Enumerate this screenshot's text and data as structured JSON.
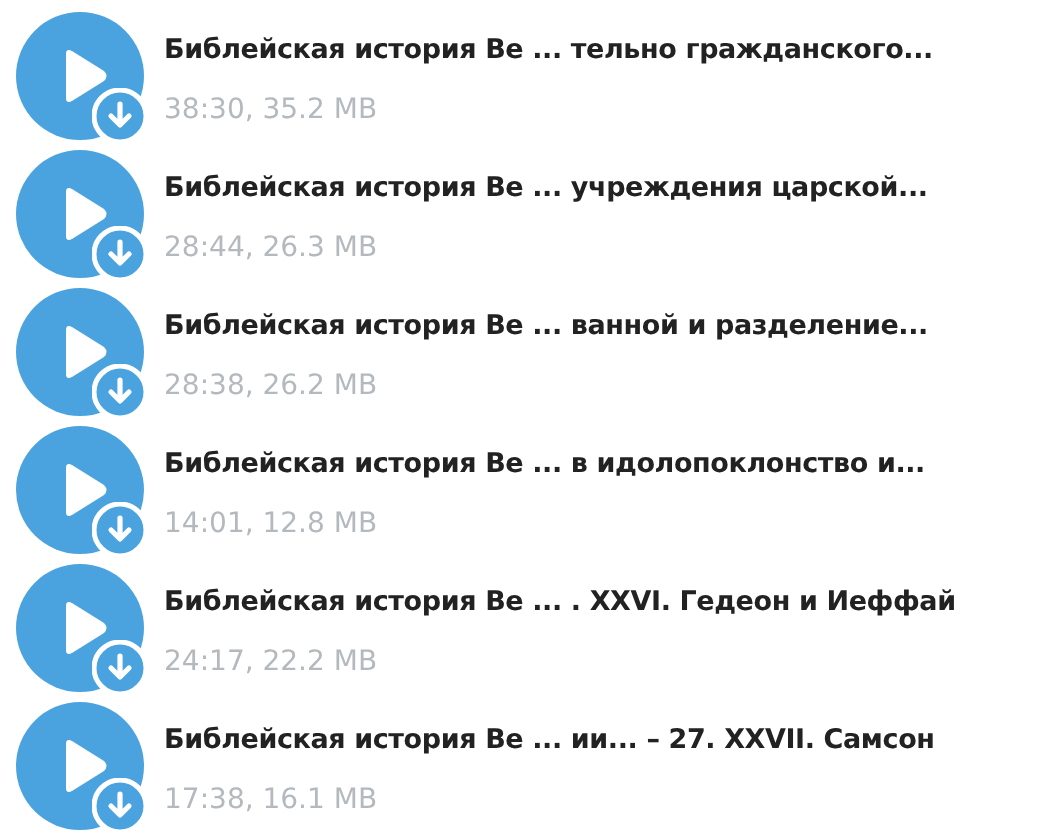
{
  "tracks": [
    {
      "title": "Библейская история Ве ... тельно гражданского...",
      "meta": "38:30, 35.2 MB"
    },
    {
      "title": "Библейская история Ве ... учреждения царской...",
      "meta": "28:44, 26.3 MB"
    },
    {
      "title": "Библейская история Ве ... ванной и разделение...",
      "meta": "28:38, 26.2 MB"
    },
    {
      "title": "Библейская история Ве ... в идолопоклонство и...",
      "meta": "14:01, 12.8 MB"
    },
    {
      "title": "Библейская история Ве ... . XXVI. Гедеон и Иеффай",
      "meta": "24:17, 22.2 MB"
    },
    {
      "title": "Библейская история Ве ... ии... – 27. XXVII. Самсон",
      "meta": "17:38, 16.1 MB"
    }
  ]
}
